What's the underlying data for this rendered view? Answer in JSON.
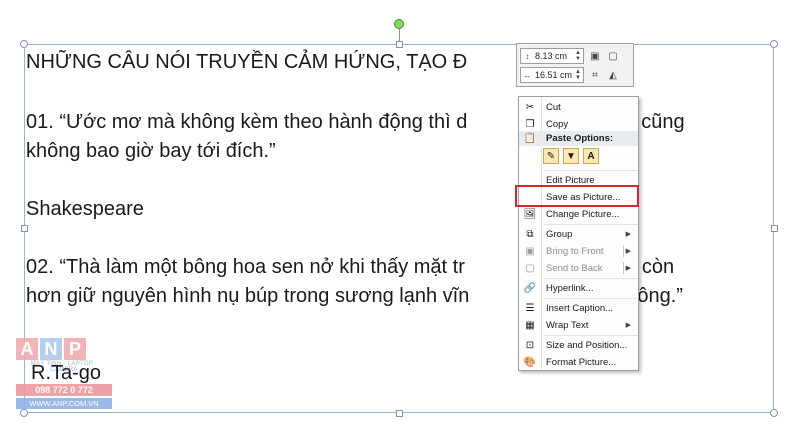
{
  "document": {
    "title_line": "NHỮNG CÂU NÓI TRUYỀN CẢM HỨNG, TẠO Đ",
    "para1_line1": "01. “Ước mơ mà không kèm theo hành động thì d",
    "para1_line1_tail": "cánh cũng",
    "para1_line2": "không bao giờ bay tới đích.”",
    "author1": "Shakespeare",
    "para2_line1": "02. “Thà làm một bông hoa sen nở khi thấy mặt tr",
    "para2_line1_tail": "nhụy còn",
    "para2_line2": "hơn giữ nguyên hình nụ búp trong sương lạnh vĩn",
    "para2_line2_tail": "nùa đông.”",
    "author2": "R.Ta-go"
  },
  "minibar": {
    "height_value": "8.13 cm",
    "width_value": "16.51 cm",
    "height_icon": "height-icon",
    "width_icon": "width-icon"
  },
  "context_menu": {
    "items": [
      {
        "label": "Cut",
        "icon": "scissors-icon",
        "disabled": false
      },
      {
        "label": "Copy",
        "icon": "copy-icon",
        "disabled": false
      },
      {
        "label": "Paste Options:",
        "icon": "paste-icon",
        "section": true
      },
      {
        "label": "Edit Picture",
        "disabled": false
      },
      {
        "label": "Save as Picture...",
        "disabled": false,
        "highlighted": true
      },
      {
        "label": "Change Picture...",
        "icon": "change-picture-icon",
        "disabled": false
      },
      {
        "label": "Group",
        "icon": "group-icon",
        "disabled": false,
        "submenu": true
      },
      {
        "label": "Bring to Front",
        "icon": "bring-front-icon",
        "disabled": true,
        "submenu": true
      },
      {
        "label": "Send to Back",
        "icon": "send-back-icon",
        "disabled": true,
        "submenu": true
      },
      {
        "label": "Hyperlink...",
        "icon": "hyperlink-icon",
        "disabled": false
      },
      {
        "label": "Insert Caption...",
        "icon": "caption-icon",
        "disabled": false
      },
      {
        "label": "Wrap Text",
        "icon": "wrap-text-icon",
        "disabled": false,
        "submenu": true
      },
      {
        "label": "Size and Position...",
        "icon": "size-position-icon",
        "disabled": false
      },
      {
        "label": "Format Picture...",
        "icon": "format-picture-icon",
        "disabled": false
      }
    ],
    "paste_buttons": [
      "A"
    ]
  },
  "watermark": {
    "letters": [
      "A",
      "N",
      "P"
    ],
    "tagline": "MÁY TÍNH · LAPTOP · CAMERA",
    "phone": "098 772 0 772",
    "website": "WWW.ANP.COM.VN"
  },
  "colors": {
    "highlight_border": "#d9262c",
    "selection_border": "#9bb3d3",
    "rotate_handle": "#7ed957"
  }
}
